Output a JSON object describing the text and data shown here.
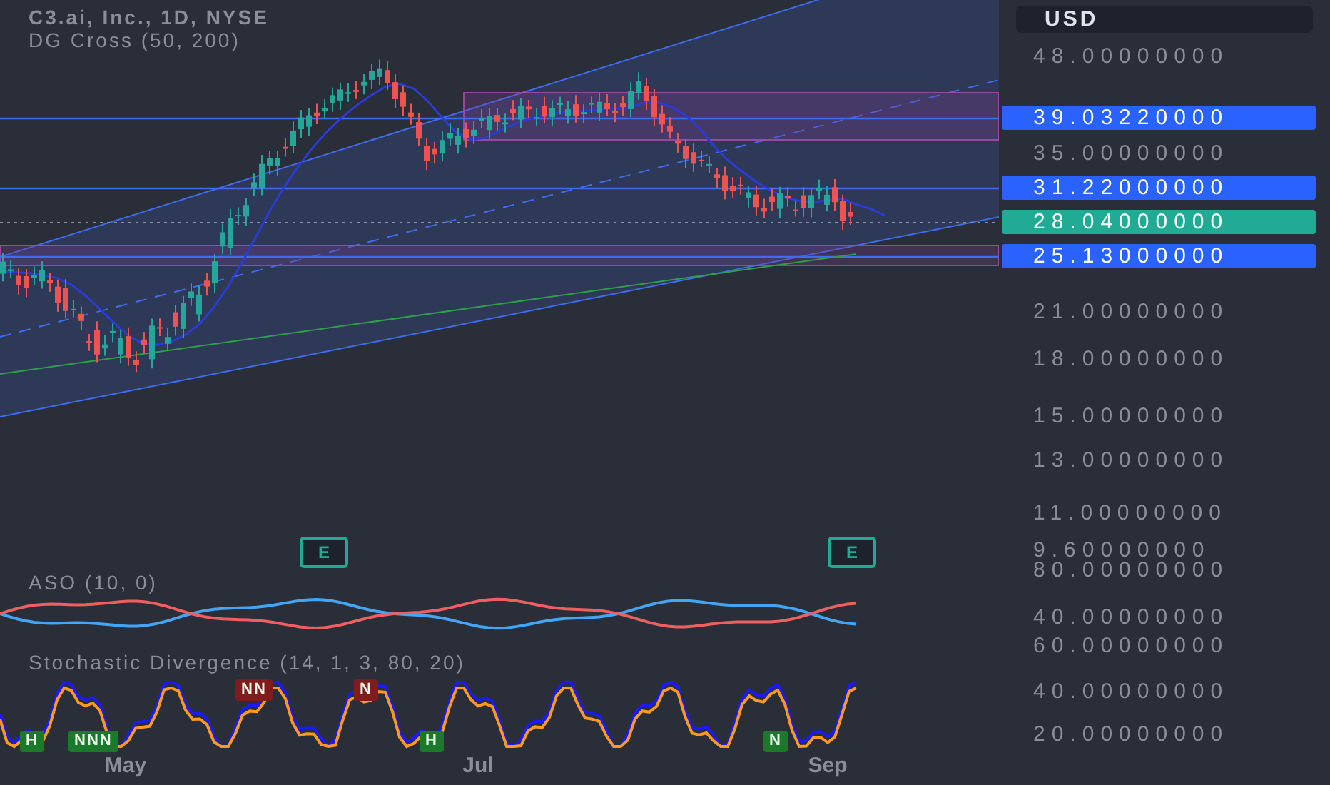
{
  "legend": {
    "symbol": "C3.ai, Inc., 1D, NYSE",
    "indicator": "DG Cross (50, 200)"
  },
  "indicators": [
    {
      "title": "ASO (10, 0)"
    },
    {
      "title": "Stochastic Divergence (14, 1, 3, 80, 20)"
    }
  ],
  "earnings_markers": [
    "E",
    "E"
  ],
  "signal_badges": [
    {
      "text": "NN",
      "color": "#801c1c"
    },
    {
      "text": "N",
      "color": "#801c1c"
    },
    {
      "text": "H",
      "color": "#1b7a2a"
    },
    {
      "text": "NNN",
      "color": "#1b7a2a"
    },
    {
      "text": "H",
      "color": "#1b7a2a"
    },
    {
      "text": "N",
      "color": "#1b7a2a"
    }
  ],
  "price_axis": {
    "currency": "USD",
    "labels": [
      "48.00000000",
      "35.00000000",
      "21.00000000",
      "18.00000000",
      "15.00000000",
      "13.00000000",
      "11.00000000",
      "9.60000000",
      "80.00000000",
      "40.00000000",
      "60.00000000",
      "40.00000000",
      "20.00000000"
    ],
    "price_tags": [
      {
        "text": "39.03220000",
        "color": "#2962ff"
      },
      {
        "text": "31.22000000",
        "color": "#2962ff"
      },
      {
        "text": "28.04000000",
        "color": "#22ab94"
      },
      {
        "text": "25.13000000",
        "color": "#2962ff"
      }
    ]
  },
  "time_axis": [
    "May",
    "Jul",
    "Sep"
  ]
}
